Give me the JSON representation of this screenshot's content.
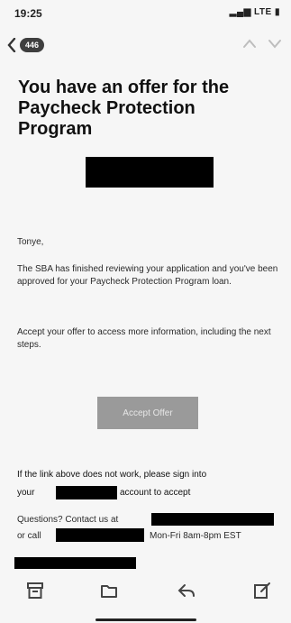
{
  "status_bar": {
    "time": "19:25",
    "signal": "LTE"
  },
  "nav": {
    "unread_count": "446"
  },
  "email": {
    "subject": "You have an offer for the Paycheck Protection Program",
    "greeting": "Tonye,",
    "paragraph1": "The SBA has finished reviewing your application and you've been approved for your Paycheck Protection Program loan.",
    "paragraph2": "Accept your offer to access more information, including the next steps.",
    "accept_button": "Accept Offer",
    "fallback_part1": "If the link above does not work, please sign into",
    "fallback_your": "your",
    "fallback_part2": "account to accept",
    "questions_label": "Questions? Contact us at",
    "or_call": "or call",
    "hours": "Mon-Fri 8am-8pm EST"
  },
  "toolbar": {
    "icons": [
      "archive-icon",
      "folder-icon",
      "reply-icon",
      "compose-icon"
    ]
  }
}
